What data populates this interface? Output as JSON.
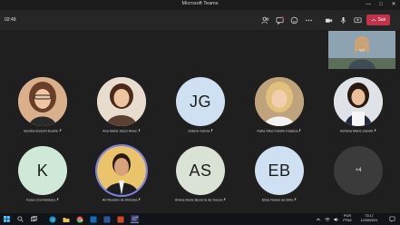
{
  "window": {
    "title": "Microsoft Teams"
  },
  "meeting": {
    "timer": "02:49",
    "leave_label": "Sair"
  },
  "participants": [
    {
      "name": "Sandra Bossini Duarte",
      "type": "photo",
      "bg": "#c9a88a"
    },
    {
      "name": "Ana Maria Sacci Alves",
      "type": "photo",
      "bg": "#d6c0a6"
    },
    {
      "name": "Juliana Garcia",
      "type": "initials",
      "initials": "JG",
      "bg": "#cfe0f3"
    },
    {
      "name": "Katia Silva Farello Falasca",
      "type": "photo",
      "bg": "#d8c39a"
    },
    {
      "name": "Adriana Maria Zanetti",
      "type": "photo",
      "bg": "#e8e8ea"
    },
    {
      "name": "Karen (Convidado)",
      "type": "initials",
      "initials": "K",
      "bg": "#cfe8d8"
    },
    {
      "name": "Ari Ricardo de Almeida",
      "type": "photo",
      "bg": "#3a3a3a"
    },
    {
      "name": "Ariane Assis Bezerra de Souza",
      "type": "initials",
      "initials": "AS",
      "bg": "#d9e2d5"
    },
    {
      "name": "Elisa Nunes de Brito",
      "type": "initials",
      "initials": "EB",
      "bg": "#cfe0f3"
    }
  ],
  "overflow": {
    "label": "+4"
  },
  "taskbar": {
    "weather": "",
    "lang_line1": "POR",
    "lang_line2": "PTB2",
    "time": "73:17",
    "date": "12/09/2021"
  },
  "colors": {
    "leave": "#c4314b",
    "speaking_ring": "#7b83eb"
  }
}
